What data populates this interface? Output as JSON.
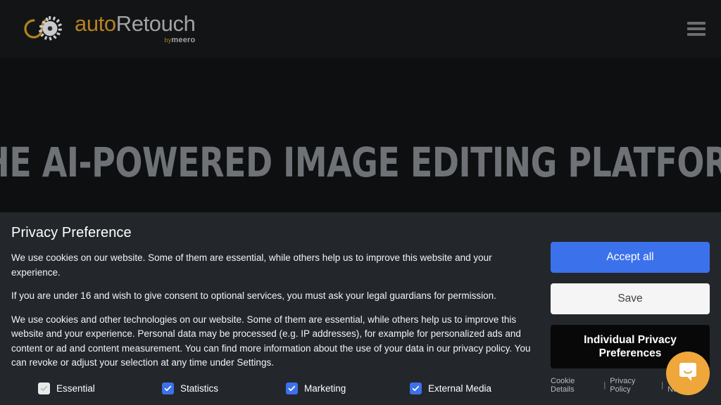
{
  "header": {
    "logo": {
      "mark_icon": "aperture-gear-logo-icon",
      "word_first": "auto",
      "word_second": "Retouch",
      "sub_by": "by",
      "sub_brand": "meero"
    },
    "menu_icon": "hamburger-menu-icon"
  },
  "hero": {
    "title": "The AI-powered image editing platform"
  },
  "privacy": {
    "title": "Privacy Preference",
    "paragraphs": [
      "We use cookies on our website. Some of them are essential, while others help us to improve this website and your experience.",
      "If you are under 16 and wish to give consent to optional services, you must ask your legal guardians for permission.",
      "We use cookies and other technologies on our website. Some of them are essential, while others help us to improve this website and your experience. Personal data may be processed (e.g. IP addresses), for example for personalized ads and content or ad and content measurement. You can find more information about the use of your data in our privacy policy. You can revoke or adjust your selection at any time under Settings."
    ],
    "consents": [
      {
        "label": "Essential",
        "checked": true,
        "disabled": true
      },
      {
        "label": "Statistics",
        "checked": true,
        "disabled": false
      },
      {
        "label": "Marketing",
        "checked": true,
        "disabled": false
      },
      {
        "label": "External Media",
        "checked": true,
        "disabled": false
      }
    ],
    "buttons": {
      "accept_all": "Accept all",
      "save": "Save",
      "individual": "Individual Privacy Preferences"
    },
    "links": [
      "Cookie Details",
      "Privacy Policy",
      "Legal Notice"
    ],
    "link_separator": "|"
  },
  "chat": {
    "icon": "chat-bubble-smile-icon"
  },
  "colors": {
    "accent_blue": "#3b71eb",
    "brand_gold": "#b3821f",
    "chat_orange": "#efa63b",
    "banner_bg": "#23272b",
    "page_bg": "#0e0f10",
    "hero_text": "#6e7276"
  }
}
